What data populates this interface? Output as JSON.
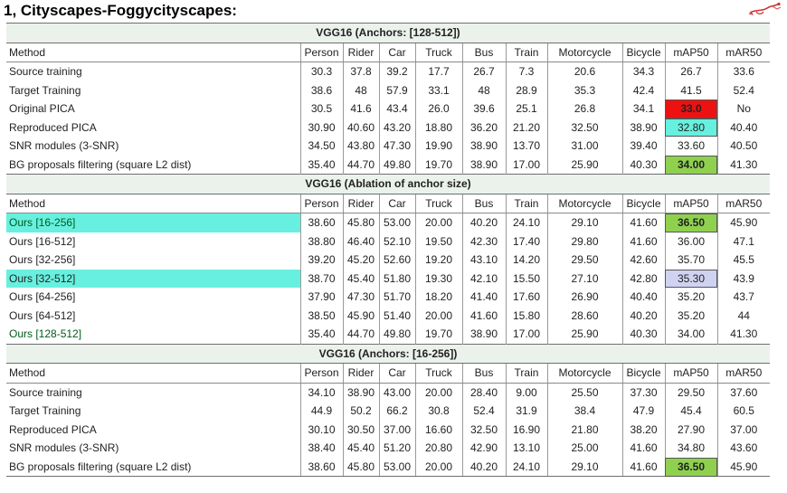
{
  "title": "1, Cityscapes-Foggycityscapes:",
  "decoration_icon": "red-bird-sketch",
  "colors": {
    "red": "#ee1111",
    "cyan": "#67f0df",
    "green": "#8fd14f",
    "lavender": "#cfd3f1",
    "green_text": "#005a1a",
    "section_bg": "#ebf2ec"
  },
  "header": [
    "Method",
    "Person",
    "Rider",
    "Car",
    "Truck",
    "Bus",
    "Train",
    "Motorcycle",
    "Bicycle",
    "mAP50",
    "mAR50"
  ],
  "sections": [
    {
      "title": "VGG16 (Anchors: [128-512])",
      "rows": [
        {
          "cells": [
            "Source training",
            "30.3",
            "37.8",
            "39.2",
            "17.7",
            "26.7",
            "7.3",
            "20.6",
            "34.3",
            "26.7",
            "33.6"
          ]
        },
        {
          "cells": [
            "Target Training",
            "38.6",
            "48",
            "57.9",
            "33.1",
            "48",
            "28.9",
            "35.3",
            "42.4",
            "41.5",
            "52.4"
          ]
        },
        {
          "cells": [
            "Original PICA",
            "30.5",
            "41.6",
            "43.4",
            "26.0",
            "39.6",
            "25.1",
            "26.8",
            "34.1",
            "33.0",
            "No"
          ],
          "map_bg": "red",
          "map_bold": true
        },
        {
          "cells": [
            "Reproduced PICA",
            "30.90",
            "40.60",
            "43.20",
            "18.80",
            "36.20",
            "21.20",
            "32.50",
            "38.90",
            "32.80",
            "40.40"
          ],
          "map_bg": "cyan"
        },
        {
          "cells": [
            "SNR modules (3-SNR)",
            "34.50",
            "43.80",
            "47.30",
            "19.90",
            "38.90",
            "13.70",
            "31.00",
            "39.40",
            "33.60",
            "40.50"
          ]
        },
        {
          "cells": [
            "BG proposals filtering (square L2 dist)",
            "35.40",
            "44.70",
            "49.80",
            "19.70",
            "38.90",
            "17.00",
            "25.90",
            "40.30",
            "34.00",
            "41.30"
          ],
          "map_bg": "green",
          "map_bold": true
        }
      ]
    },
    {
      "title": "VGG16 (Ablation of anchor size)",
      "rows": [
        {
          "cells": [
            "Ours [16-256]",
            "38.60",
            "45.80",
            "53.00",
            "20.00",
            "40.20",
            "24.10",
            "29.10",
            "41.60",
            "36.50",
            "45.90"
          ],
          "method_bg": "cyan",
          "method_green": true,
          "map_bg": "green",
          "map_bold": true
        },
        {
          "cells": [
            "Ours [16-512]",
            "38.80",
            "46.40",
            "52.10",
            "19.50",
            "42.30",
            "17.40",
            "29.80",
            "41.60",
            "36.00",
            "47.1"
          ]
        },
        {
          "cells": [
            "Ours [32-256]",
            "39.20",
            "45.20",
            "52.60",
            "19.20",
            "43.10",
            "14.20",
            "29.50",
            "42.60",
            "35.70",
            "45.5"
          ]
        },
        {
          "cells": [
            "Ours [32-512]",
            "38.70",
            "45.40",
            "51.80",
            "19.30",
            "42.10",
            "15.50",
            "27.10",
            "42.80",
            "35.30",
            "43.9"
          ],
          "method_bg": "cyan",
          "map_bg": "lavender"
        },
        {
          "cells": [
            "Ours [64-256]",
            "37.90",
            "47.30",
            "51.70",
            "18.20",
            "41.40",
            "17.60",
            "26.90",
            "40.40",
            "35.20",
            "43.7"
          ]
        },
        {
          "cells": [
            "Ours [64-512]",
            "38.50",
            "45.90",
            "51.40",
            "20.00",
            "41.60",
            "15.80",
            "28.60",
            "40.20",
            "35.20",
            "44"
          ]
        },
        {
          "cells": [
            "Ours [128-512]",
            "35.40",
            "44.70",
            "49.80",
            "19.70",
            "38.90",
            "17.00",
            "25.90",
            "40.30",
            "34.00",
            "41.30"
          ],
          "method_green": true
        }
      ]
    },
    {
      "title": "VGG16 (Anchors: [16-256])",
      "rows": [
        {
          "cells": [
            "Source training",
            "34.10",
            "38.90",
            "43.00",
            "20.00",
            "28.40",
            "9.00",
            "25.50",
            "37.30",
            "29.50",
            "37.60"
          ]
        },
        {
          "cells": [
            "Target Training",
            "44.9",
            "50.2",
            "66.2",
            "30.8",
            "52.4",
            "31.9",
            "38.4",
            "47.9",
            "45.4",
            "60.5"
          ]
        },
        {
          "cells": [
            "Reproduced PICA",
            "30.10",
            "30.50",
            "37.00",
            "16.60",
            "32.50",
            "16.90",
            "21.80",
            "38.20",
            "27.90",
            "37.00"
          ]
        },
        {
          "cells": [
            "SNR modules (3-SNR)",
            "38.40",
            "45.40",
            "51.20",
            "20.80",
            "42.90",
            "13.10",
            "25.00",
            "41.60",
            "34.80",
            "43.60"
          ]
        },
        {
          "cells": [
            "BG proposals filtering (square L2 dist)",
            "38.60",
            "45.80",
            "53.00",
            "20.00",
            "40.20",
            "24.10",
            "29.10",
            "41.60",
            "36.50",
            "45.90"
          ],
          "map_bg": "green",
          "map_bold": true
        }
      ]
    }
  ]
}
